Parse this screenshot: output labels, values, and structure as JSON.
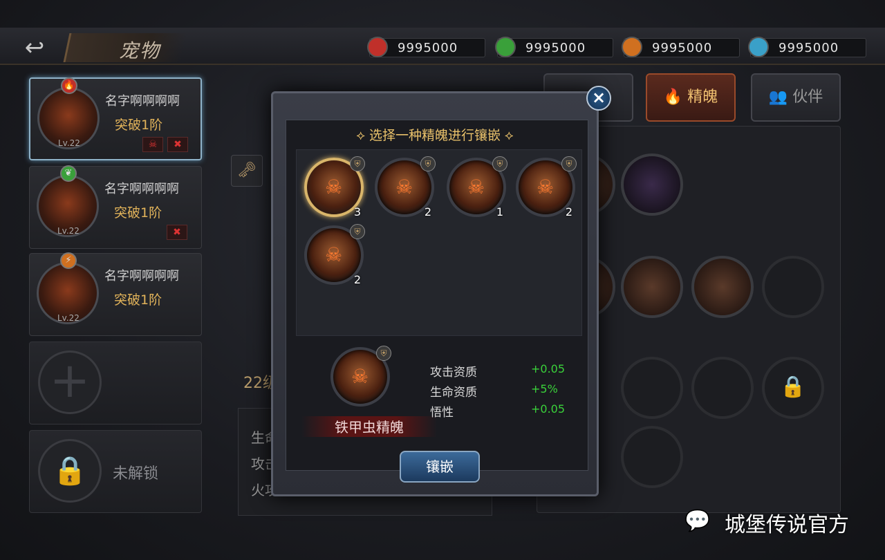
{
  "header": {
    "back_icon": "back-arrow-icon",
    "title": "宠物"
  },
  "resources": [
    {
      "icon": "red-gem-icon",
      "color": "#c0302a",
      "value": "9995000"
    },
    {
      "icon": "green-gem-icon",
      "color": "#3aa03a",
      "value": "9995000"
    },
    {
      "icon": "lightning-gem-icon",
      "color": "#d07020",
      "value": "9995000"
    },
    {
      "icon": "ice-gem-icon",
      "color": "#3aa0c8",
      "value": "9995000"
    }
  ],
  "pets": [
    {
      "name": "名字啊啊啊啊",
      "stage": "突破1阶",
      "level": "Lv.22",
      "element": "fire-icon",
      "elem_glyph": "🔥",
      "elem_color": "#c0302a"
    },
    {
      "name": "名字啊啊啊啊",
      "stage": "突破1阶",
      "level": "Lv.22",
      "element": "leaf-icon",
      "elem_glyph": "❦",
      "elem_color": "#3aa03a"
    },
    {
      "name": "名字啊啊啊啊",
      "stage": "突破1阶",
      "level": "Lv.22",
      "element": "lightning-icon",
      "elem_glyph": "⚡",
      "elem_color": "#d07020"
    }
  ],
  "locked_label": "未解锁",
  "tabs": {
    "soul": "精魄",
    "partner": "伙伴"
  },
  "left_panel": {
    "level": "22级",
    "lines": [
      "生命",
      "攻击",
      "火攻"
    ]
  },
  "modal": {
    "title": "选择一种精魄进行镶嵌",
    "gems": [
      {
        "count": "3"
      },
      {
        "count": "2"
      },
      {
        "count": "1"
      },
      {
        "count": "2"
      },
      {
        "count": "2"
      }
    ],
    "selected_name": "铁甲虫精魄",
    "stats": [
      {
        "label": "攻击资质",
        "value": "+0.05"
      },
      {
        "label": "生命资质",
        "value": "+5%"
      },
      {
        "label": "悟性",
        "value": "+0.05"
      }
    ],
    "confirm": "镶嵌"
  },
  "watermark": "城堡传说官方"
}
